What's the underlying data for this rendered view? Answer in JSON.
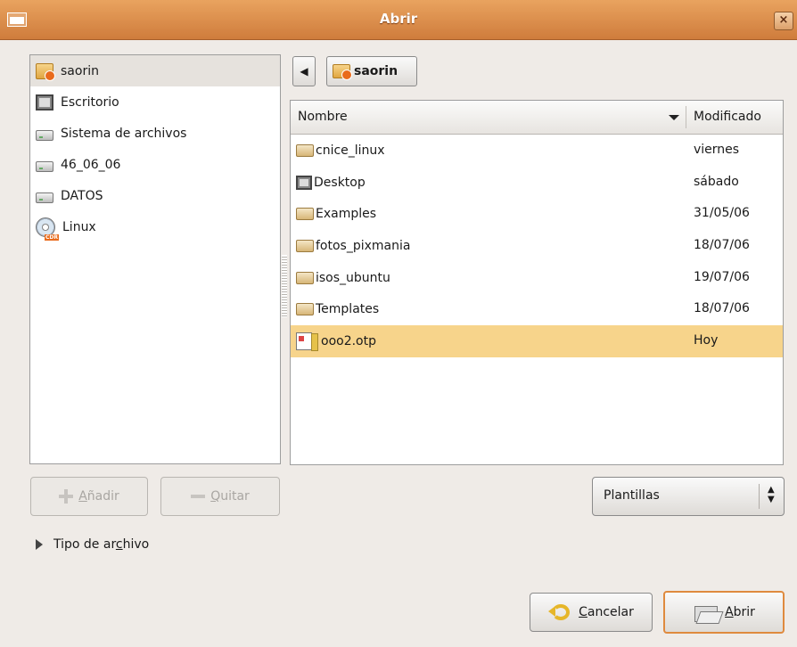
{
  "window": {
    "title": "Abrir"
  },
  "places": [
    {
      "label": "saorin",
      "icon": "home-folder-icon",
      "selected": true
    },
    {
      "label": "Escritorio",
      "icon": "desktop-icon"
    },
    {
      "label": "Sistema de archivos",
      "icon": "drive-icon"
    },
    {
      "label": "46_06_06",
      "icon": "drive-icon"
    },
    {
      "label": "DATOS",
      "icon": "drive-icon"
    },
    {
      "label": "Linux",
      "icon": "cdrom-icon"
    }
  ],
  "path_bar": {
    "current": "saorin"
  },
  "file_list": {
    "columns": {
      "name": "Nombre",
      "modified": "Modificado"
    },
    "rows": [
      {
        "name": "cnice_linux",
        "modified": "viernes",
        "icon": "folder-icon"
      },
      {
        "name": "Desktop",
        "modified": "sábado",
        "icon": "desktop-icon"
      },
      {
        "name": "Examples",
        "modified": "31/05/06",
        "icon": "folder-icon"
      },
      {
        "name": "fotos_pixmania",
        "modified": "18/07/06",
        "icon": "folder-icon"
      },
      {
        "name": "isos_ubuntu",
        "modified": "19/07/06",
        "icon": "folder-icon"
      },
      {
        "name": "Templates",
        "modified": "18/07/06",
        "icon": "folder-icon"
      },
      {
        "name": "ooo2.otp",
        "modified": "Hoy",
        "icon": "document-icon",
        "selected": true
      }
    ]
  },
  "buttons": {
    "add": {
      "pre": "",
      "mnemonic": "A",
      "post": "ñadir"
    },
    "remove": {
      "pre": "",
      "mnemonic": "Q",
      "post": "uitar"
    },
    "cancel": {
      "pre": "",
      "mnemonic": "C",
      "post": "ancelar"
    },
    "open": {
      "pre": "",
      "mnemonic": "A",
      "post": "brir"
    }
  },
  "filter": {
    "selected": "Plantillas"
  },
  "expander": {
    "pre": "Tipo de ar",
    "mnemonic": "c",
    "post": "hivo"
  },
  "colors": {
    "titlebar": "#d98c4b",
    "selection": "#f7d48b",
    "open_button_border": "#df8a3e"
  }
}
